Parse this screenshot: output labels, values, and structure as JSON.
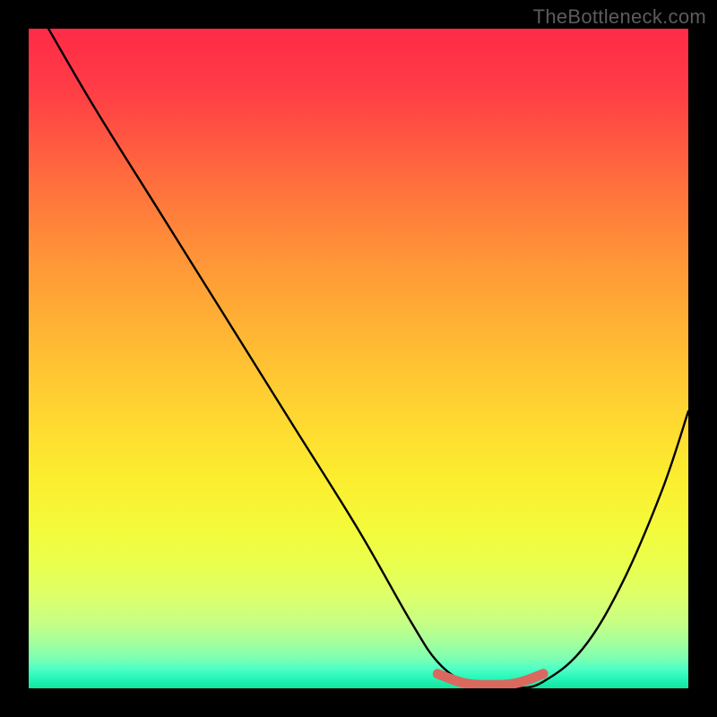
{
  "watermark": "TheBottleneck.com",
  "chart_data": {
    "type": "line",
    "title": "",
    "xlabel": "",
    "ylabel": "",
    "xlim": [
      0,
      100
    ],
    "ylim": [
      0,
      100
    ],
    "series": [
      {
        "name": "bottleneck-curve",
        "x": [
          3,
          10,
          20,
          30,
          40,
          50,
          58,
          62,
          66,
          70,
          74,
          78,
          84,
          90,
          96,
          100
        ],
        "values": [
          100,
          88,
          72,
          56,
          40,
          24,
          10,
          4,
          1,
          0,
          0,
          1,
          6,
          16,
          30,
          42
        ]
      }
    ],
    "highlight": {
      "name": "optimal-range",
      "x": [
        62,
        66,
        70,
        74,
        78
      ],
      "values": [
        2.2,
        0.8,
        0.5,
        0.8,
        2.2
      ],
      "color": "#d9695f"
    },
    "gradient_stops": [
      {
        "pos": 0,
        "color": "#ff2a47"
      },
      {
        "pos": 50,
        "color": "#ffc933"
      },
      {
        "pos": 80,
        "color": "#f2ff40"
      },
      {
        "pos": 100,
        "color": "#13e39a"
      }
    ]
  }
}
